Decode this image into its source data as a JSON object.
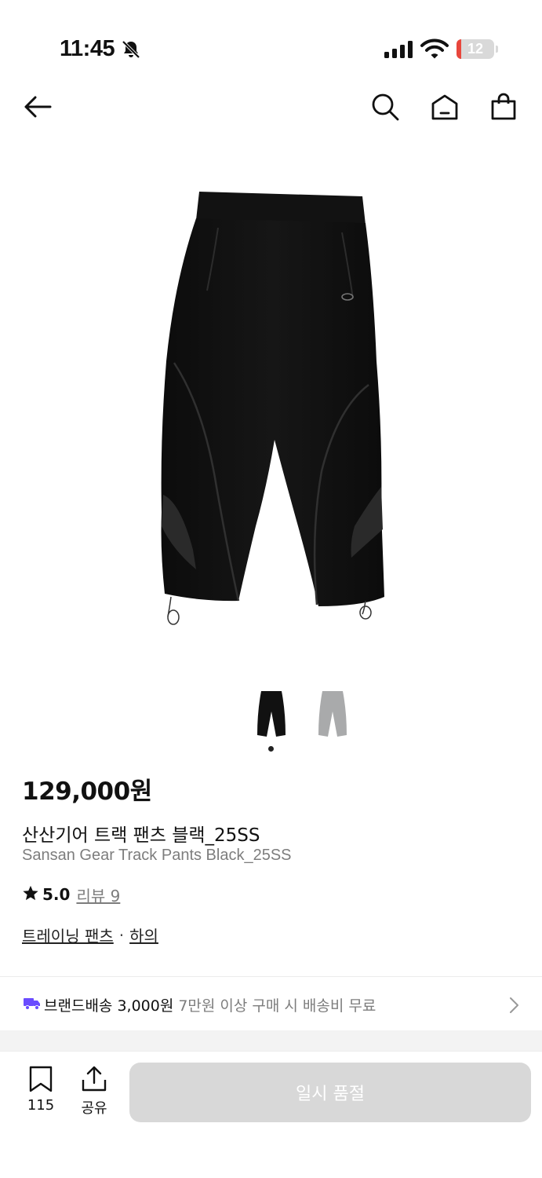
{
  "status": {
    "time": "11:45",
    "battery": "12",
    "battery_level": 0.12
  },
  "nav": {
    "icons": [
      "back-arrow-icon",
      "search-icon",
      "home-icon",
      "shopping-bag-icon"
    ]
  },
  "gallery": {
    "current_index": 1,
    "total": 2,
    "thumbnail_colors": [
      "#111111",
      "#a9aaab"
    ]
  },
  "product": {
    "price": "129,000원",
    "name_ko": "산산기어 트랙 팬츠 블랙_25SS",
    "name_en": "Sansan Gear Track Pants Black_25SS",
    "rating": "5.0",
    "review_link": "리뷰 9",
    "category_sub": "트레이닝 팬츠",
    "category_sep": "·",
    "category_main": "하의"
  },
  "shipping": {
    "label": "브랜드배송 3,000원",
    "note": "7만원 이상 구매 시 배송비 무료",
    "icon_color": "#6a4cff"
  },
  "bottom": {
    "bookmark_count": "115",
    "share_label": "공유",
    "cta_label": "일시 품절"
  },
  "colors": {
    "accent": "#6a4cff",
    "text_secondary": "#7d7d7d",
    "disabled_button": "#d8d8d8"
  }
}
